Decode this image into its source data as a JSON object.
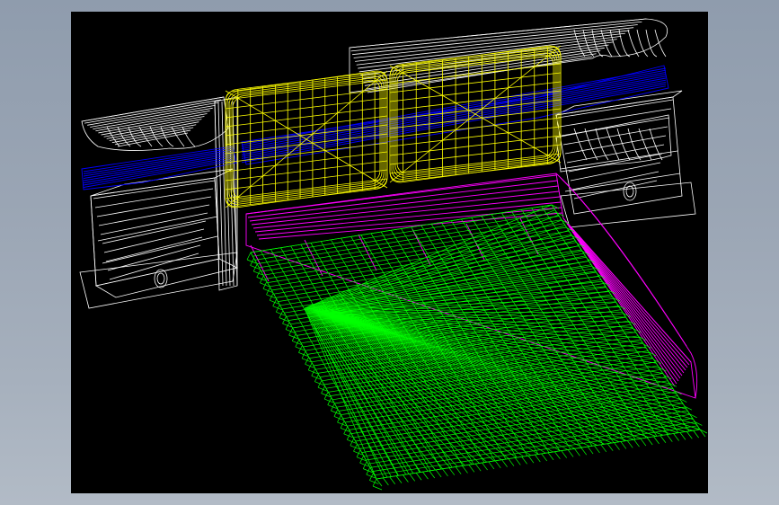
{
  "app": {
    "title": ""
  },
  "viewport": {
    "mode": "wireframe",
    "background": "#000000",
    "frame_color": "#9aa5b4"
  },
  "model": {
    "parts": [
      {
        "name": "pillows",
        "color": "#ffff00"
      },
      {
        "name": "mattress",
        "color": "#00ff00"
      },
      {
        "name": "bed-frame",
        "color": "#ff00ff"
      },
      {
        "name": "light-strips",
        "color": "#0000ff"
      },
      {
        "name": "nightstands-and-headboard",
        "color": "#ffffff"
      }
    ]
  }
}
